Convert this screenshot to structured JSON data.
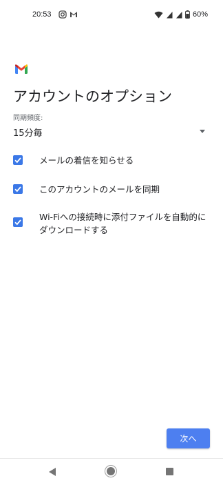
{
  "status_bar": {
    "time": "20:53",
    "battery": "60%",
    "icons": [
      "instagram-icon",
      "gmail-small-icon",
      "wifi-icon",
      "signal-icon",
      "signal-icon",
      "battery-icon"
    ]
  },
  "header": {
    "logo": "gmail-logo",
    "title": "アカウントのオプション"
  },
  "sync": {
    "label": "同期頻度:",
    "selected": "15分毎"
  },
  "options": [
    {
      "label": "メールの着信を知らせる",
      "checked": true
    },
    {
      "label": "このアカウントのメールを同期",
      "checked": true
    },
    {
      "label": "Wi-Fiへの接続時に添付ファイルを自動的にダウンロードする",
      "checked": true
    }
  ],
  "footer": {
    "next_label": "次へ"
  },
  "colors": {
    "accent": "#4d7ff0",
    "checkbox": "#3b78e7"
  },
  "nav_bar": {
    "icons": [
      "back-icon",
      "home-icon",
      "recents-icon"
    ]
  }
}
